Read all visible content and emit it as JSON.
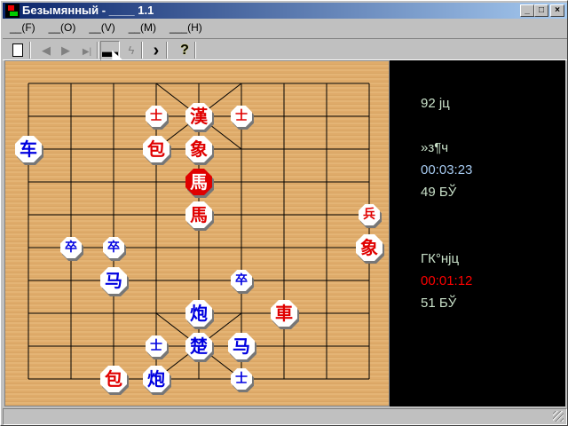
{
  "window": {
    "title": "Безымянный - ____ 1.1"
  },
  "menu": [
    "__(F)",
    "__(O)",
    "__(V)",
    "__(M)",
    "___(H)"
  ],
  "toolbar": [
    {
      "name": "new-icon",
      "glyph": "🗋"
    },
    {
      "name": "first-move-icon",
      "glyph": "◀"
    },
    {
      "name": "next-icon",
      "glyph": "▶"
    },
    {
      "name": "last-move-icon",
      "glyph": "▶|"
    },
    {
      "name": "board-icon",
      "glyph": "▬"
    },
    {
      "name": "hint-icon",
      "glyph": "ϟ"
    },
    {
      "name": "go-icon",
      "glyph": "›"
    },
    {
      "name": "help-icon",
      "glyph": "?"
    }
  ],
  "side": {
    "moves": "92 jц",
    "player1_label": "»з¶ч",
    "player1_time": "00:03:23",
    "player1_steps": "49 БЎ",
    "player2_label": "ГК°нjц",
    "player2_time": "00:01:12",
    "player2_steps": "51 БЎ"
  },
  "colors": {
    "red": "#e00000",
    "blue": "#0000e0",
    "time1": "#a6caf0",
    "time2": "#ff0000",
    "text": "#c8e0c8"
  },
  "pieces": [
    {
      "c": "漢",
      "side": "red",
      "col": 4,
      "row": 1,
      "big": true
    },
    {
      "c": "士",
      "side": "red",
      "col": 3,
      "row": 1
    },
    {
      "c": "士",
      "side": "red",
      "col": 5,
      "row": 1
    },
    {
      "c": "包",
      "side": "red",
      "col": 3,
      "row": 2,
      "big": true
    },
    {
      "c": "象",
      "side": "red",
      "col": 4,
      "row": 2,
      "big": true
    },
    {
      "c": "馬",
      "side": "red",
      "col": 4,
      "row": 3,
      "big": true,
      "selected": true
    },
    {
      "c": "馬",
      "side": "red",
      "col": 4,
      "row": 4,
      "big": true
    },
    {
      "c": "兵",
      "side": "red",
      "col": 8,
      "row": 4
    },
    {
      "c": "象",
      "side": "red",
      "col": 8,
      "row": 5,
      "big": true
    },
    {
      "c": "車",
      "side": "red",
      "col": 6,
      "row": 7,
      "big": true
    },
    {
      "c": "包",
      "side": "red",
      "col": 2,
      "row": 9,
      "big": true
    },
    {
      "c": "车",
      "side": "blue",
      "col": 0,
      "row": 2,
      "big": true
    },
    {
      "c": "卒",
      "side": "blue",
      "col": 1,
      "row": 5
    },
    {
      "c": "卒",
      "side": "blue",
      "col": 2,
      "row": 5
    },
    {
      "c": "马",
      "side": "blue",
      "col": 2,
      "row": 6,
      "big": true
    },
    {
      "c": "卒",
      "side": "blue",
      "col": 5,
      "row": 6
    },
    {
      "c": "炮",
      "side": "blue",
      "col": 4,
      "row": 7,
      "big": true
    },
    {
      "c": "楚",
      "side": "blue",
      "col": 4,
      "row": 8,
      "big": true
    },
    {
      "c": "士",
      "side": "blue",
      "col": 3,
      "row": 8
    },
    {
      "c": "马",
      "side": "blue",
      "col": 5,
      "row": 8,
      "big": true
    },
    {
      "c": "炮",
      "side": "blue",
      "col": 3,
      "row": 9,
      "big": true
    },
    {
      "c": "士",
      "side": "blue",
      "col": 5,
      "row": 9
    }
  ]
}
